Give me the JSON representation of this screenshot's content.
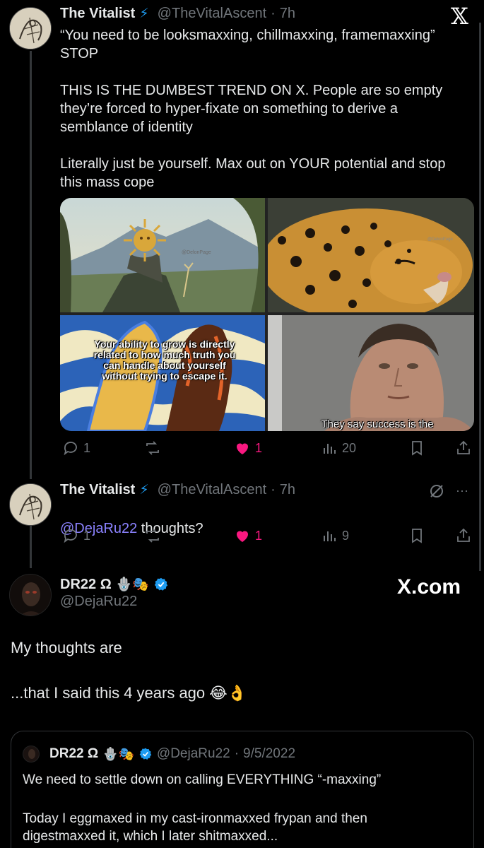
{
  "brand": {
    "x_logo": "𝕏",
    "watermark": "X.com"
  },
  "tweet1": {
    "name": "The Vitalist",
    "emoji": "⚡",
    "handle": "@TheVitalAscent",
    "dot": "·",
    "time": "7h",
    "text": "“You need to be looksmaxxing, chillmaxxing, framemaxxing”\nSTOP\n\nTHIS IS THE DUMBEST TREND ON X. People are so empty they’re forced to hyper-fixate on something to derive a semblance of identity\n\nLiterally just be yourself. Max out on YOUR potential and stop this mass cope",
    "media": {
      "tl_watermark": "@DelonPage",
      "tr_watermark": "@DelonPage",
      "bl_caption": "Your ability to grow is directly related to how much truth you can handle about yourself without trying to escape it.",
      "br_caption": "They say success is the"
    },
    "stats": {
      "replies": "1",
      "likes": "1",
      "views": "20"
    }
  },
  "tweet2": {
    "name": "The Vitalist",
    "emoji": "⚡",
    "handle": "@TheVitalAscent",
    "dot": "·",
    "time": "7h",
    "mention": "@DejaRu22",
    "text": " thoughts?",
    "more": "···",
    "stats": {
      "replies": "1",
      "likes": "1",
      "views": "9"
    }
  },
  "tweet3": {
    "name": "DR22 Ω",
    "emojis": "🪬🎭",
    "handle": "@DejaRu22",
    "line1": "My thoughts are",
    "line2": "...that I said this 4 years ago",
    "line2_emojis": "😂👌"
  },
  "quote": {
    "name": "DR22 Ω",
    "emojis": "🪬🎭",
    "handle": "@DejaRu22",
    "dot": "·",
    "date": "9/5/2022",
    "line1": "We need to settle down on calling EVERYTHING “-maxxing”",
    "line2": "Today I eggmaxed in my cast-ironmaxxed frypan and then digestmaxxed it, which I later shitmaxxed..."
  },
  "colors": {
    "accent": "#1d9bf0",
    "like": "#f91880",
    "mention": "#8b82ff",
    "muted": "#71767b"
  }
}
